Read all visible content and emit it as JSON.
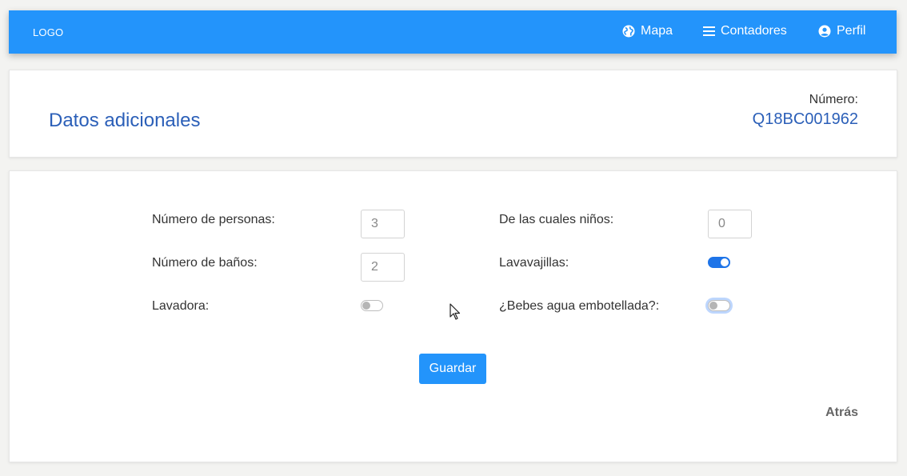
{
  "navbar": {
    "logo": "LOGO",
    "items": [
      {
        "label": "Mapa",
        "icon": "globe-icon"
      },
      {
        "label": "Contadores",
        "icon": "menu-icon"
      },
      {
        "label": "Perfil",
        "icon": "user-circle-icon"
      }
    ],
    "color": "#2394fb"
  },
  "header": {
    "title": "Datos adicionales",
    "numero_label": "Número:",
    "numero_value": "Q18BC001962"
  },
  "form": {
    "personas": {
      "label": "Número de personas:",
      "value": "3"
    },
    "ninos": {
      "label": "De las cuales niños:",
      "value": "0"
    },
    "banos": {
      "label": "Número de baños:",
      "value": "2"
    },
    "lavavajillas": {
      "label": "Lavavajillas:",
      "checked": true
    },
    "lavadora": {
      "label": "Lavadora:",
      "checked": false
    },
    "agua": {
      "label": "¿Bebes agua embotellada?:",
      "checked": false
    },
    "save_label": "Guardar",
    "back_label": "Atrás"
  }
}
